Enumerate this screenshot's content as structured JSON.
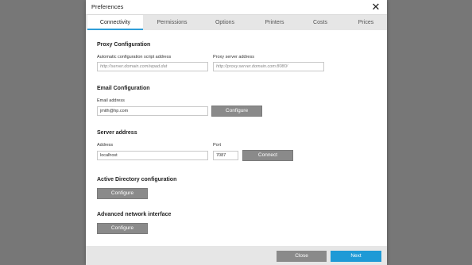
{
  "window": {
    "title": "Preferences",
    "close_glyph": "✕"
  },
  "tabs": [
    {
      "label": "Connectivity",
      "active": true
    },
    {
      "label": "Permissions",
      "active": false
    },
    {
      "label": "Options",
      "active": false
    },
    {
      "label": "Printers",
      "active": false
    },
    {
      "label": "Costs",
      "active": false
    },
    {
      "label": "Prices",
      "active": false
    }
  ],
  "proxy": {
    "section_title": "Proxy Configuration",
    "auto_label": "Automatic configuration script address",
    "auto_placeholder": "http://server.domain.com/wpad.dat",
    "server_label": "Proxy server address",
    "server_placeholder": "http://proxy.server.domain.com:8080/"
  },
  "email": {
    "section_title": "Email Configuration",
    "address_label": "Email address",
    "address_value": "jmith@hp.com",
    "configure_label": "Configure"
  },
  "server": {
    "section_title": "Server address",
    "address_label": "Address",
    "address_value": "localhost",
    "port_label": "Port",
    "port_value": "7087",
    "connect_label": "Connect"
  },
  "active_directory": {
    "section_title": "Active Directory configuration",
    "configure_label": "Configure"
  },
  "advanced_network": {
    "section_title": "Advanced network interface",
    "configure_label": "Configure"
  },
  "footer": {
    "close_label": "Close",
    "next_label": "Next"
  },
  "colors": {
    "accent": "#1e9ad6",
    "secondary_button": "#8a8a8a",
    "backdrop": "#777777"
  }
}
